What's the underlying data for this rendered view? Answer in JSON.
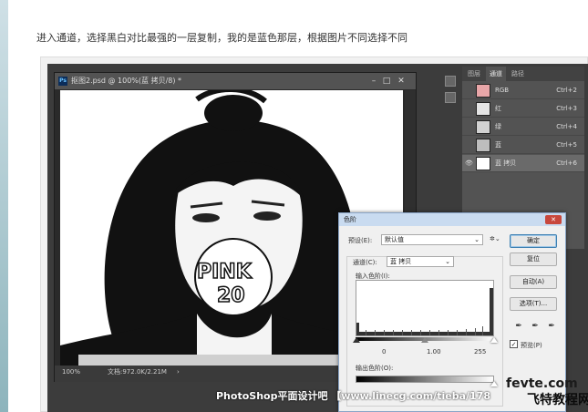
{
  "caption": "进入通道，选择黑白对比最强的一层复制，我的是蓝色那层，根据图片不同选择不同",
  "doc": {
    "title": "抠图2.psd @ 100%(蓝 拷贝/8) *",
    "status_zoom": "100%",
    "status_info": "文档:972.0K/2.21M",
    "badge_line1": "PINK",
    "badge_line2": "20"
  },
  "panel": {
    "tabs": [
      "图层",
      "通道",
      "路径"
    ],
    "active_tab": "通道",
    "channels": [
      {
        "name": "RGB",
        "key": "Ctrl+2",
        "visible": false,
        "selected": false
      },
      {
        "name": "红",
        "key": "Ctrl+3",
        "visible": false,
        "selected": false
      },
      {
        "name": "绿",
        "key": "Ctrl+4",
        "visible": false,
        "selected": false
      },
      {
        "name": "蓝",
        "key": "Ctrl+5",
        "visible": false,
        "selected": false
      },
      {
        "name": "蓝 拷贝",
        "key": "Ctrl+6",
        "visible": true,
        "selected": true
      }
    ]
  },
  "levels": {
    "title": "色阶",
    "close": "✕",
    "preset_label": "预设(E):",
    "preset_value": "默认值",
    "channel_label": "通道(C):",
    "channel_value": "蓝 拷贝",
    "input_label": "输入色阶(I):",
    "input_values": [
      "0",
      "1.00",
      "255"
    ],
    "output_label": "输出色阶(O):",
    "buttons": {
      "ok": "确定",
      "reset": "复位",
      "auto": "自动(A)",
      "options": "选项(T)..."
    },
    "preview_label": "预览(P)",
    "preview_checked": true
  },
  "watermark": "PhotoShop平面设计吧 【www.linecg.com/tieba/178",
  "site_logo_line1": "fevte.com",
  "site_logo_line2": "飞特教程网",
  "colors": {
    "ps_dark": "#3c3c3c",
    "panel": "#535353",
    "dialog": "#f0f0f0",
    "dialog_title": "#c9dbf0",
    "close_red": "#c8473c"
  }
}
